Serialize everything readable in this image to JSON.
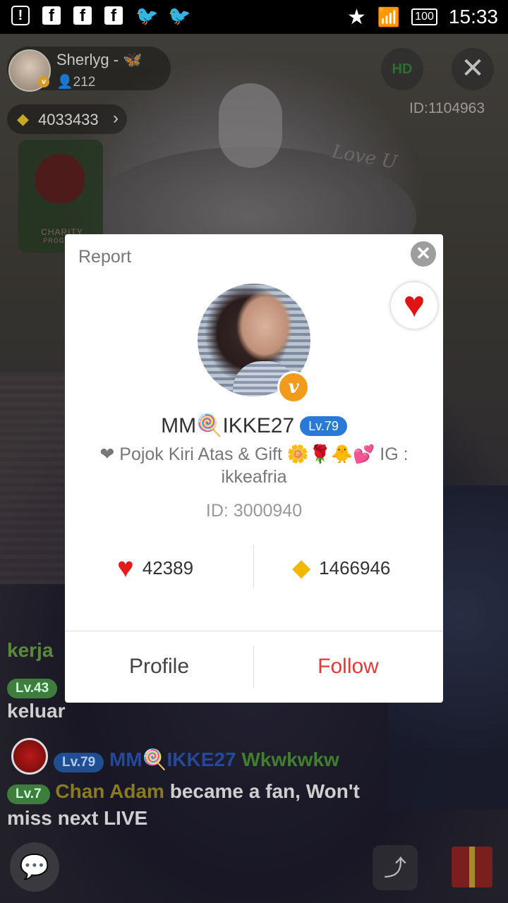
{
  "status_bar": {
    "time": "15:33",
    "battery": "100",
    "icons": [
      "alert-icon",
      "facebook-icon",
      "facebook-icon",
      "facebook-icon",
      "twitter-icon",
      "twitter-icon",
      "star-icon",
      "wifi-icon",
      "battery-icon"
    ]
  },
  "stream": {
    "host_name": "Sherlyg - 🦋",
    "viewer_count": "212",
    "diamonds": "4033433",
    "hd_label": "HD",
    "room_id": "ID:1104963",
    "charity_label": "CHARITY",
    "charity_sub": "PROGRAM",
    "sticker_text": "Love U"
  },
  "chat": {
    "messages": [
      {
        "text": "kerja"
      },
      {
        "level": "Lv.43",
        "text": "keluar"
      },
      {
        "level": "Lv.79",
        "user": "MM🍭IKKE27",
        "text": "Wkwkwkw"
      },
      {
        "level": "Lv.7",
        "user": "Chan Adam",
        "text": "became a fan, Won't",
        "text2": "miss next LIVE"
      }
    ]
  },
  "dialog": {
    "report_label": "Report",
    "username": "MM🍭IKKE27",
    "level": "Lv.79",
    "bio": "❤ Pojok Kiri Atas & Gift 🌼🌹🐥💕 IG : ikkeafria",
    "user_id": "ID: 3000940",
    "hearts": "42389",
    "diamonds": "1466946",
    "profile_label": "Profile",
    "follow_label": "Follow",
    "accent_follow": "#e53935",
    "level_color": "#2979d6"
  }
}
